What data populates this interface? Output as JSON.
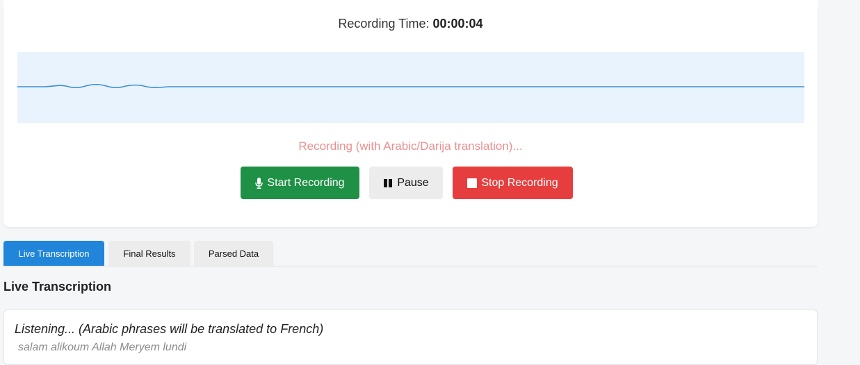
{
  "recorder": {
    "timer_label": "Recording Time:",
    "timer_value": "00:00:04",
    "status_text": "Recording (with Arabic/Darija translation)...",
    "start_label": "Start Recording",
    "pause_label": "Pause",
    "stop_label": "Stop Recording"
  },
  "tabs": [
    {
      "label": "Live Transcription",
      "active": true
    },
    {
      "label": "Final Results",
      "active": false
    },
    {
      "label": "Parsed Data",
      "active": false
    }
  ],
  "transcription": {
    "section_title": "Live Transcription",
    "listening_text": "Listening... (Arabic phrases will be translated to French)",
    "interim_text": "salam alikoum Allah Meryem lundi"
  },
  "colors": {
    "start": "#1f9146",
    "stop": "#e63e3e",
    "tab_active": "#2185d9",
    "status": "#ec8f8f",
    "wave": "#3b8fd0"
  },
  "icons": {
    "start": "microphone-icon",
    "pause": "pause-icon",
    "stop": "stop-icon"
  }
}
